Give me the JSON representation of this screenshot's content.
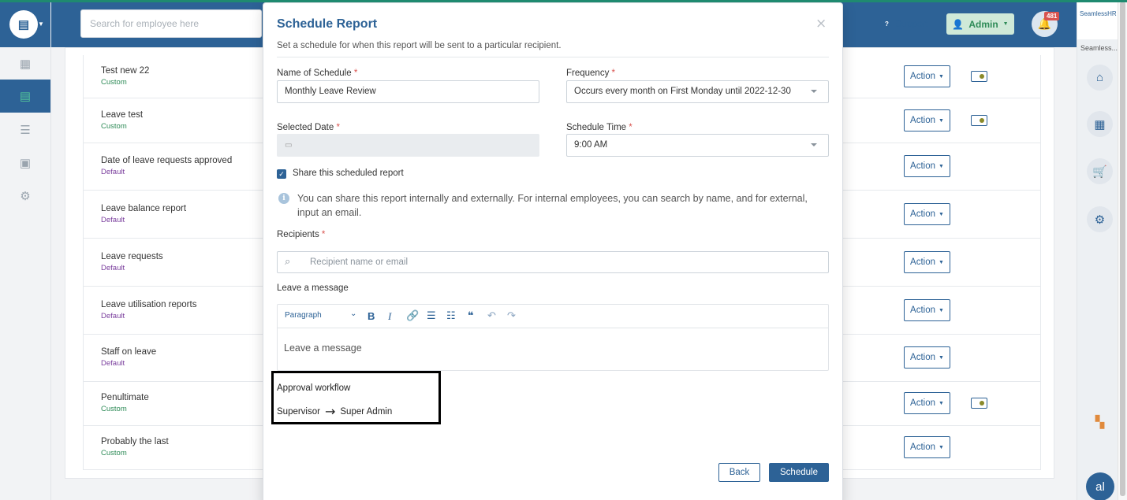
{
  "header": {
    "search_placeholder": "Search for employee here",
    "support_label": "Support",
    "admin_label": "Admin",
    "notifications_count": "481"
  },
  "right_panel": {
    "brand": "SeamlessHR",
    "caption": "Seamless...",
    "avatar_initials": "al"
  },
  "reports": [
    {
      "name": "Test new 22",
      "type": "Custom",
      "action": "Action",
      "toggle": true
    },
    {
      "name": "Leave test",
      "type": "Custom",
      "action": "Action",
      "toggle": true
    },
    {
      "name": "Date of leave requests approved",
      "type": "Default",
      "action": "Action",
      "toggle": false
    },
    {
      "name": "Leave balance report",
      "type": "Default",
      "action": "Action",
      "toggle": false
    },
    {
      "name": "Leave requests",
      "type": "Default",
      "action": "Action",
      "toggle": false
    },
    {
      "name": "Leave utilisation reports",
      "type": "Default",
      "action": "Action",
      "toggle": false
    },
    {
      "name": "Staff on leave",
      "type": "Default",
      "action": "Action",
      "toggle": false
    },
    {
      "name": "Penultimate",
      "type": "Custom",
      "action": "Action",
      "toggle": true
    },
    {
      "name": "Probably the last",
      "type": "Custom",
      "action": "Action",
      "toggle": false
    }
  ],
  "modal": {
    "title": "Schedule Report",
    "close": "×",
    "subtitle": "Set a schedule for when this report will be sent to a particular recipient.",
    "name_label": "Name of Schedule",
    "name_value": "Monthly Leave Review",
    "frequency_label": "Frequency",
    "frequency_value": "Occurs every month on First Monday until 2022-12-30",
    "date_label": "Selected Date",
    "date_value": "",
    "time_label": "Schedule Time",
    "time_value": "9:00 AM",
    "required_mark": "*",
    "share_label": "Share this scheduled report",
    "share_checked": true,
    "info_text": "You can share this report internally and externally. For internal employees, you can search by name, and for external, input an email.",
    "recipients_label": "Recipients",
    "recipients_placeholder": "Recipient name or email",
    "message_label": "Leave a message",
    "editor_paragraph": "Paragraph",
    "editor_placeholder": "Leave a message",
    "workflow_title": "Approval workflow",
    "workflow_steps": [
      "Supervisor",
      "Super Admin"
    ],
    "back_label": "Back",
    "schedule_label": "Schedule"
  },
  "colors": {
    "primary": "#2d6296",
    "accent_green": "#52c49a",
    "required": "#d9534f"
  }
}
